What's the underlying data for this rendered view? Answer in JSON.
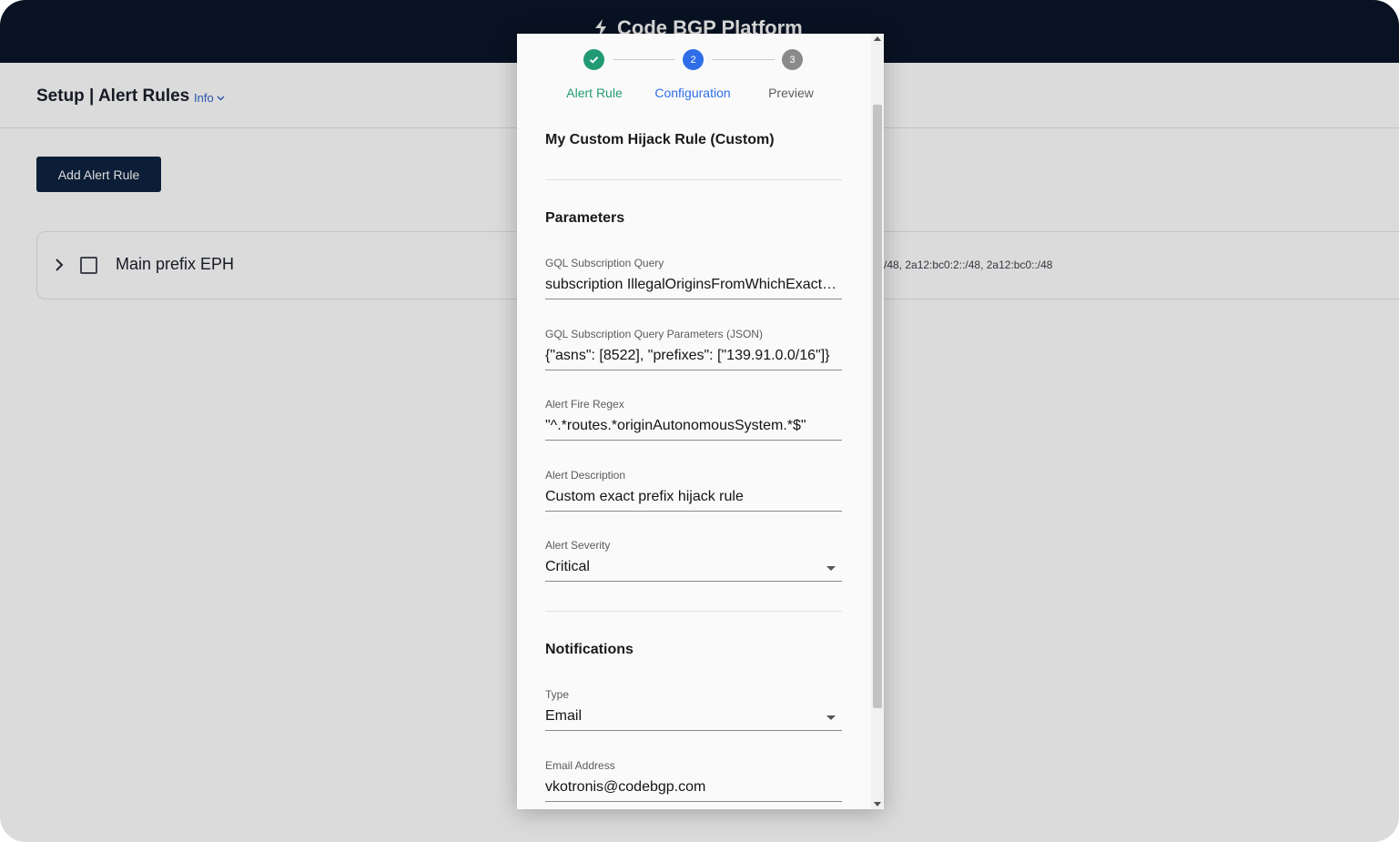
{
  "app": {
    "brand": "Code BGP Platform"
  },
  "page": {
    "title": "Setup | Alert Rules",
    "info_label": "Info"
  },
  "toolbar": {
    "add_label": "Add Alert Rule"
  },
  "rules": [
    {
      "name": "Main prefix EPH",
      "prefixes": "/48, 2a12:bc0:2::/48, 2a12:bc0::/48"
    }
  ],
  "wizard": {
    "steps": [
      {
        "number": "",
        "label": "Alert Rule",
        "state": "done"
      },
      {
        "number": "2",
        "label": "Configuration",
        "state": "active"
      },
      {
        "number": "3",
        "label": "Preview",
        "state": "pending"
      }
    ],
    "rule_title": "My Custom Hijack Rule (Custom)",
    "parameters_heading": "Parameters",
    "fields": {
      "gql_query": {
        "label": "GQL Subscription Query",
        "value": "subscription IllegalOriginsFromWhichExactPrefixHijack"
      },
      "gql_params": {
        "label": "GQL Subscription Query Parameters (JSON)",
        "value": "{\"asns\": [8522], \"prefixes\": [\"139.91.0.0/16\"]}"
      },
      "fire_regex": {
        "label": "Alert Fire Regex",
        "value": "\"^.*routes.*originAutonomousSystem.*$\""
      },
      "description": {
        "label": "Alert Description",
        "value": "Custom exact prefix hijack rule"
      },
      "severity": {
        "label": "Alert Severity",
        "value": "Critical"
      }
    },
    "notifications_heading": "Notifications",
    "notification_fields": {
      "type": {
        "label": "Type",
        "value": "Email"
      },
      "email": {
        "label": "Email Address",
        "value": "vkotronis@codebgp.com"
      }
    }
  },
  "colors": {
    "done": "#219a74",
    "active": "#2f6ee8",
    "pending": "#8a8a8a",
    "topbar": "#0a1628",
    "button": "#0f2440"
  }
}
